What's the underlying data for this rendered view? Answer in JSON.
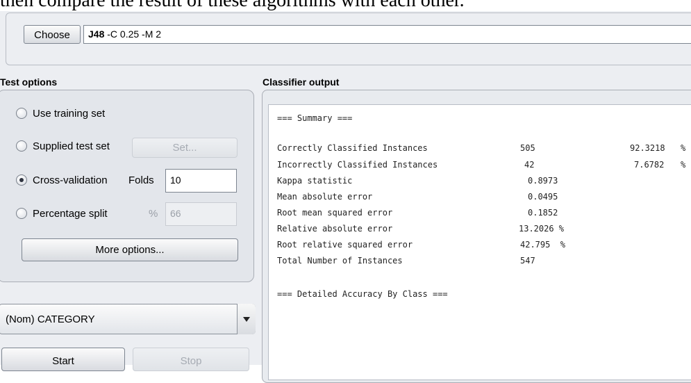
{
  "caption": "then compare the result of these algorithms with each other.",
  "classifier": {
    "choose_label": "Choose",
    "name": "J48",
    "options": "-C 0.25 -M 2"
  },
  "test_options": {
    "title": "Test options",
    "use_training_set": "Use training set",
    "supplied_test_set": "Supplied test set",
    "set_button": "Set...",
    "cross_validation": "Cross-validation",
    "folds_label": "Folds",
    "folds_value": "10",
    "percentage_split": "Percentage split",
    "percent_symbol": "%",
    "percentage_value": "66",
    "more_options": "More options..."
  },
  "class_attribute": "(Nom) CATEGORY",
  "start_button": "Start",
  "stop_button": "Stop",
  "output": {
    "title": "Classifier output",
    "summary_header": "=== Summary ===",
    "rows": [
      {
        "label": "Correctly Classified Instances",
        "v1": "505",
        "v2": "92.3218",
        "pct": "%"
      },
      {
        "label": "Incorrectly Classified Instances",
        "v1": "42",
        "v2": "7.6782",
        "pct": "%"
      },
      {
        "label": "Kappa statistic",
        "v1": "0.8973"
      },
      {
        "label": "Mean absolute error",
        "v1": "0.0495"
      },
      {
        "label": "Root mean squared error",
        "v1": "0.1852"
      },
      {
        "label": "Relative absolute error",
        "v1": "13.2026 %"
      },
      {
        "label": "Root relative squared error",
        "v1": "42.795  %"
      },
      {
        "label": "Total Number of Instances",
        "v1": "547"
      }
    ],
    "detail_header": "=== Detailed Accuracy By Class ==="
  },
  "colors": {
    "panel_bg": "#eceef2",
    "output_bg": "#ffffff",
    "border": "#7d8590"
  }
}
